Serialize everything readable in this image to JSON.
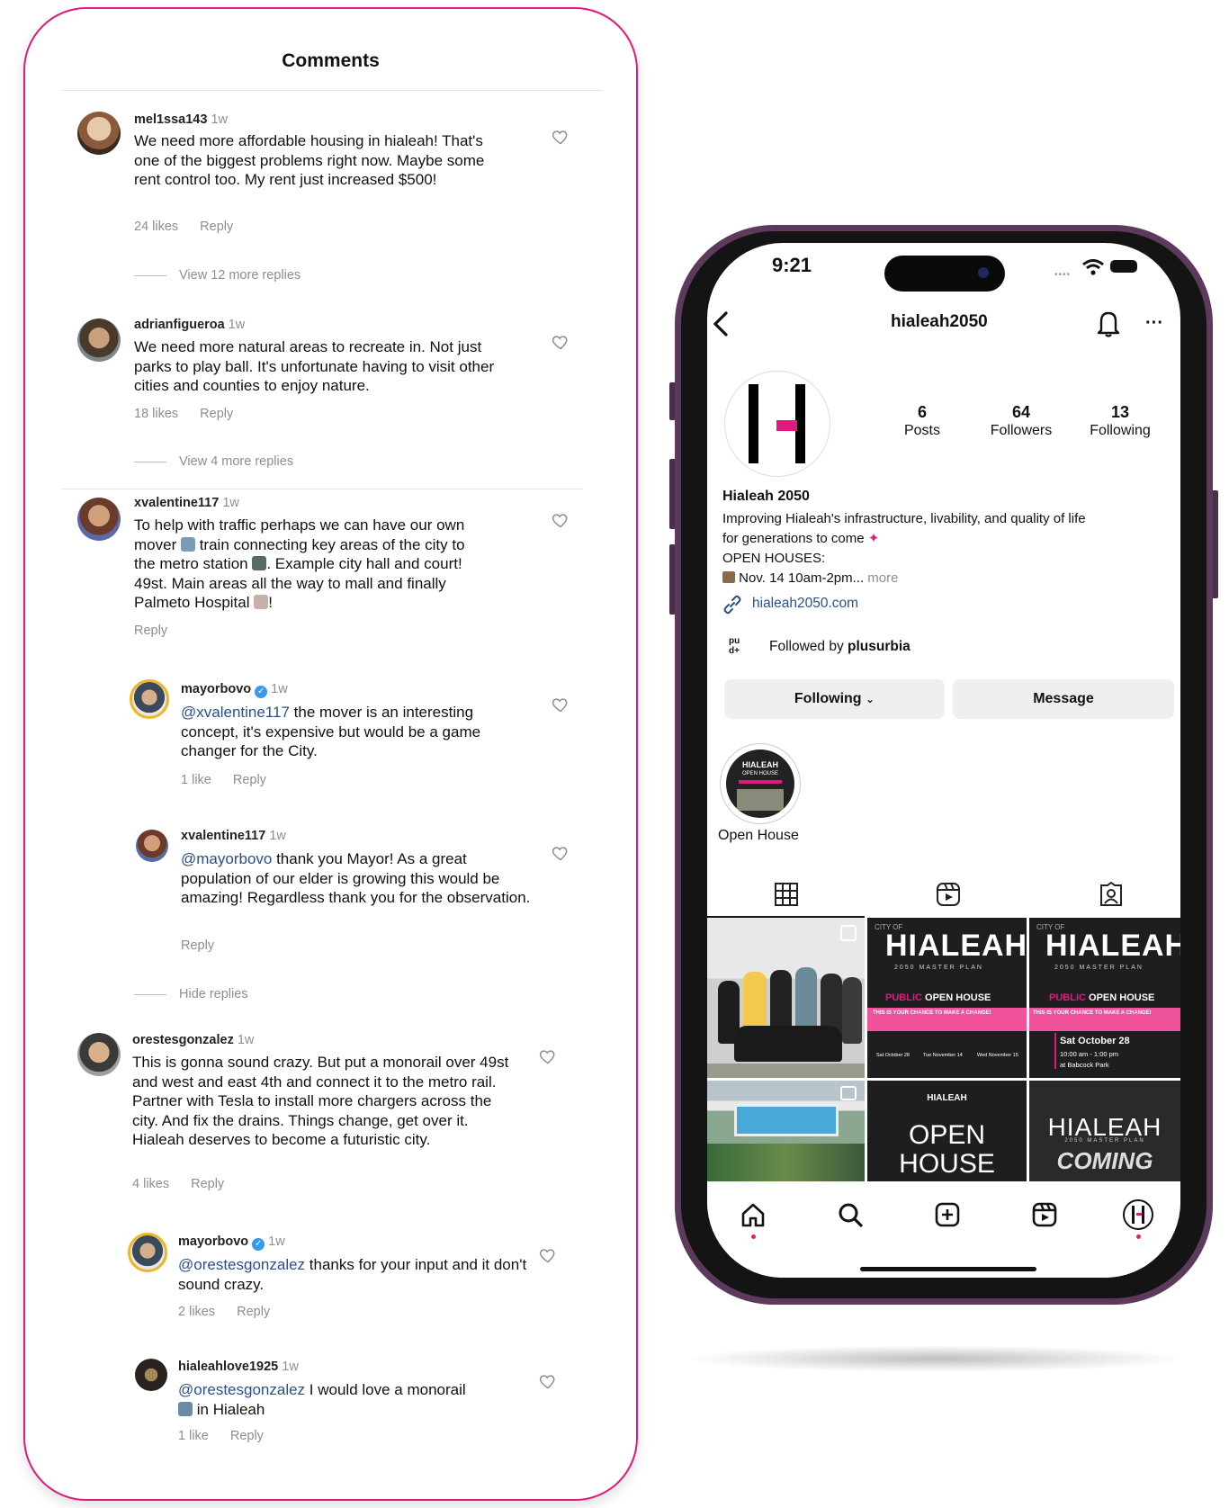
{
  "comments_panel": {
    "title": "Comments",
    "comments": [
      {
        "username": "mel1ssa143",
        "time": "1w",
        "text": "We need more affordable housing in hialeah! That's one of the biggest problems right now. Maybe some rent control too. My rent just increased $500!",
        "likes": "24 likes",
        "reply": "Reply",
        "view_more": "View 12 more replies"
      },
      {
        "username": "adrianfigueroa",
        "time": "1w",
        "text": "We need more natural areas to recreate in. Not just parks to play ball. It's unfortunate having to visit other cities and counties to enjoy nature.",
        "likes": "18 likes",
        "reply": "Reply",
        "view_more": "View 4 more replies"
      },
      {
        "username": "xvalentine117",
        "time": "1w",
        "text_1": "To help with traffic perhaps we can have our own",
        "text_2": "mover",
        "text_3": "train connecting key areas of the city to",
        "text_4": "the metro station",
        "text_5": ". Example city hall and court!",
        "text_6": "49st. Main areas all the way to mall and finally",
        "text_7": "Palmeto Hospital",
        "text_8": "!",
        "reply": "Reply"
      },
      {
        "username": "mayorbovo",
        "time": "1w",
        "mention": "@xvalentine117",
        "text": " the mover is an interesting concept, it's expensive but would be a game changer for the City.",
        "likes": "1 like",
        "reply": "Reply"
      },
      {
        "username": "xvalentine117",
        "time": "1w",
        "mention": "@mayorbovo",
        "text": " thank you Mayor! As a great population of our elder is growing this would be amazing! Regardless thank you for the observation.",
        "reply": "Reply",
        "hide": "Hide replies"
      },
      {
        "username": "orestesgonzalez",
        "time": "1w",
        "text": "This is gonna sound crazy. But put a monorail over 49st and west and east 4th and connect it to the metro rail. Partner with Tesla to install more chargers across the city. And fix the drains. Things change, get over it. Hialeah deserves to become a futuristic city.",
        "likes": "4 likes",
        "reply": "Reply"
      },
      {
        "username": "mayorbovo",
        "time": "1w",
        "mention": "@orestesgonzalez",
        "text": " thanks for your input and it don't sound crazy.",
        "likes": "2 likes",
        "reply": "Reply"
      },
      {
        "username": "hialeahlove1925",
        "time": "1w",
        "mention": "@orestesgonzalez",
        "text": " I would love a monorail",
        "text_2": "in Hialeah",
        "likes": "1 like",
        "reply": "Reply"
      }
    ]
  },
  "phone": {
    "status_time": "9:21",
    "handle": "hialeah2050",
    "stats": [
      {
        "value": "6",
        "label": "Posts"
      },
      {
        "value": "64",
        "label": "Followers"
      },
      {
        "value": "13",
        "label": "Following"
      }
    ],
    "display_name": "Hialeah 2050",
    "bio_line1": "Improving Hialeah's infrastructure, livability, and quality of life",
    "bio_line2": "for generations to come",
    "bio_line3": "OPEN HOUSES:",
    "bio_line4": "Nov. 14 10am-2pm...",
    "bio_more": "more",
    "link": "hialeah2050.com",
    "followed_by_prefix": "Followed by ",
    "followed_by_name": "plusurbia",
    "followed_logo": "pu\nd+",
    "following_btn": "Following",
    "message_btn": "Message",
    "highlight_label": "Open House",
    "highlight_text": "HIALEAH",
    "highlight_sub": "OPEN HOUSE",
    "posts": {
      "p2_city": "CITY OF",
      "p2_title": "HIALEAH",
      "p2_sub": "2050 MASTER PLAN",
      "p2_banner_pub": "PUBLIC",
      "p2_banner": "OPEN HOUSE",
      "p2_tag": "THIS IS YOUR CHANCE TO MAKE A CHANGE!",
      "p2_e1": "Sat October 28",
      "p2_e2": "Tue November 14",
      "p2_e3": "Wed November 15",
      "p3_city": "CITY OF",
      "p3_title": "HIALEAH",
      "p3_sub": "2050 MASTER PLAN",
      "p3_banner_pub": "PUBLIC",
      "p3_banner": "OPEN HOUSE",
      "p3_tag": "THIS IS YOUR CHANCE TO MAKE A CHANGE!",
      "p3_date": "Sat October 28",
      "p3_time": "10:00 am - 1:00 pm",
      "p3_place": "at Babcock Park",
      "p5_small": "HIALEAH",
      "p5_big1": "OPEN",
      "p5_big2": "HOUSE",
      "p6_title": "HIALEAH",
      "p6_sub": "2050 MASTER PLAN",
      "p6_big": "COMING"
    }
  },
  "colors": {
    "accent": "#e0197d",
    "phone_frame": "#5b3a5b",
    "link": "#2c4f8c"
  }
}
